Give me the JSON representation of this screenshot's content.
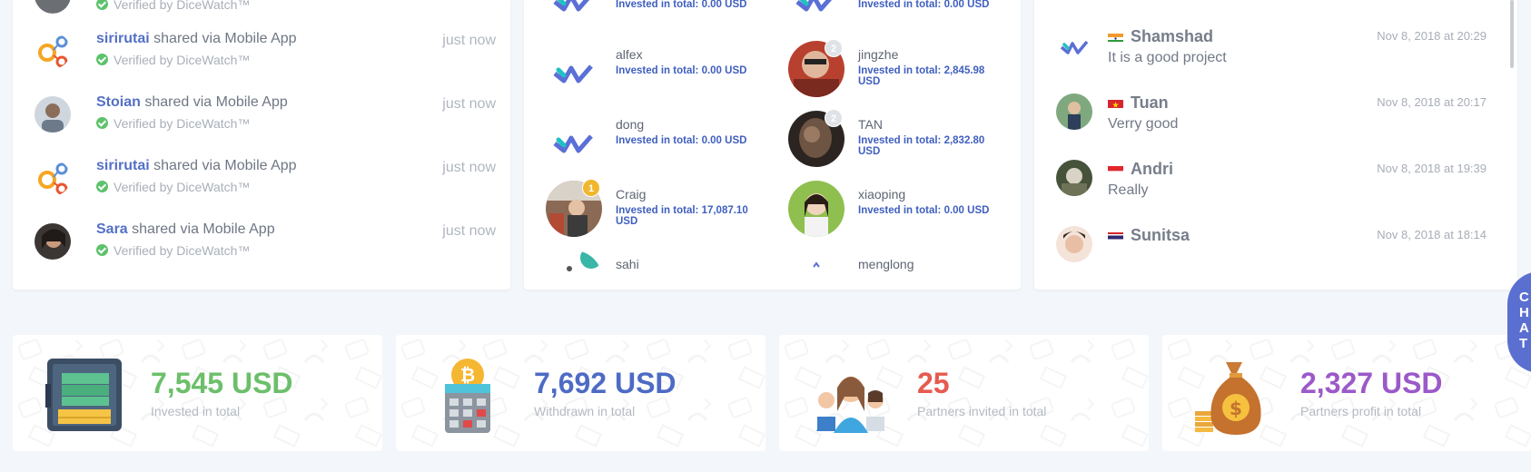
{
  "shares": {
    "items": [
      {
        "user": "",
        "action": "",
        "verified": "Verified by DiceWatch™",
        "time": "",
        "avatar": "photo-dark"
      },
      {
        "user": "sirirutai",
        "action": "shared via Mobile App",
        "verified": "Verified by DiceWatch™",
        "time": "just now",
        "avatar": "mobile-app-logo"
      },
      {
        "user": "Stoian",
        "action": "shared via Mobile App",
        "verified": "Verified by DiceWatch™",
        "time": "just now",
        "avatar": "photo-man"
      },
      {
        "user": "sirirutai",
        "action": "shared via Mobile App",
        "verified": "Verified by DiceWatch™",
        "time": "just now",
        "avatar": "mobile-app-logo"
      },
      {
        "user": "Sara",
        "action": "shared via Mobile App",
        "verified": "Verified by DiceWatch™",
        "time": "just now",
        "avatar": "photo-woman"
      }
    ]
  },
  "investors": {
    "items": [
      {
        "name": "",
        "total": "Invested in total: 0.00 USD",
        "avatar": "brand-logo",
        "badge": ""
      },
      {
        "name": "",
        "total": "Invested in total: 0.00 USD",
        "avatar": "brand-logo",
        "badge": ""
      },
      {
        "name": "alfex",
        "total": "Invested in total: 0.00 USD",
        "avatar": "brand-logo",
        "badge": ""
      },
      {
        "name": "jingzhe",
        "total": "Invested in total: 2,845.98 USD",
        "avatar": "photo",
        "badge": "2"
      },
      {
        "name": "dong",
        "total": "Invested in total: 0.00 USD",
        "avatar": "brand-logo",
        "badge": ""
      },
      {
        "name": "TAN",
        "total": "Invested in total: 2,832.80 USD",
        "avatar": "photo",
        "badge": "2"
      },
      {
        "name": "Craig",
        "total": "Invested in total: 17,087.10 USD",
        "avatar": "photo",
        "badge": "1"
      },
      {
        "name": "xiaoping",
        "total": "Invested in total: 0.00 USD",
        "avatar": "photo",
        "badge": ""
      },
      {
        "name": "sahi",
        "total": "",
        "avatar": "photo",
        "badge": ""
      },
      {
        "name": "menglong",
        "total": "",
        "avatar": "brand-logo",
        "badge": ""
      }
    ]
  },
  "comments": {
    "items": [
      {
        "name": "Shamshad",
        "flag": "in",
        "text": "It is a good project",
        "date": "Nov 8, 2018 at 20:29",
        "avatar": "brand-logo"
      },
      {
        "name": "Tuan",
        "flag": "vn",
        "text": "Verry good",
        "date": "Nov 8, 2018 at 20:17",
        "avatar": "photo"
      },
      {
        "name": "Andri",
        "flag": "id",
        "text": "Really",
        "date": "Nov 8, 2018 at 19:39",
        "avatar": "photo"
      },
      {
        "name": "Sunitsa",
        "flag": "th",
        "text": "",
        "date": "Nov 8, 2018 at 18:14",
        "avatar": "photo"
      }
    ]
  },
  "stats": [
    {
      "value": "7,545 USD",
      "label": "Invested in total",
      "color": "#6cbf6a",
      "icon": "vault-money-icon"
    },
    {
      "value": "7,692 USD",
      "label": "Withdrawn in total",
      "color": "#4d6bc5",
      "icon": "bitcoin-calculator-icon"
    },
    {
      "value": "25",
      "label": "Partners invited in total",
      "color": "#e65b4f",
      "icon": "partners-group-icon"
    },
    {
      "value": "2,327 USD",
      "label": "Partners profit in total",
      "color": "#9b59c9",
      "icon": "money-bag-icon"
    }
  ],
  "chat": {
    "letters": [
      "C",
      "H",
      "A",
      "T"
    ],
    "color": "#5b6fd1"
  },
  "colors": {
    "link": "#5470c6",
    "verified": "#5cc26b",
    "invest_text": "#3f5fbf"
  }
}
